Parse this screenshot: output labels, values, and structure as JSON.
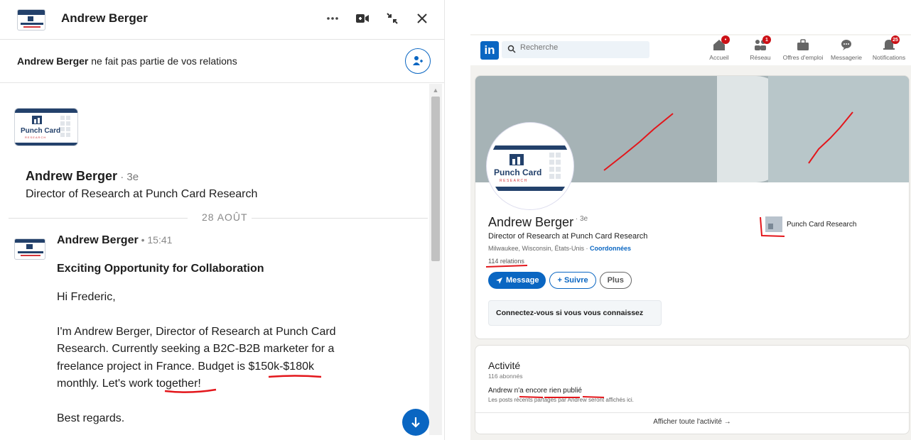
{
  "chat": {
    "header_name": "Andrew Berger",
    "notice_name": "Andrew Berger",
    "notice_rest": " ne fait pas partie de vos relations",
    "logo_text": "Punch Card",
    "logo_subtext": "RESEARCH",
    "profile_name": "Andrew Berger",
    "profile_degree": " · 3e",
    "profile_title": "Director of Research at Punch Card Research",
    "date_label": "28 AOÛT",
    "sender": "Andrew Berger",
    "time": " • 15:41",
    "subject": "Exciting Opportunity for Collaboration",
    "greeting": "Hi Frederic,",
    "body_lines": [
      "I'm Andrew Berger, Director of Research at Punch Card",
      "Research. Currently seeking a B2C-B2B marketer for a",
      "freelance project in France. Budget is $150k-$180k",
      "monthly. Let's work together!"
    ],
    "closing": "Best regards."
  },
  "linkedin": {
    "logo": "in",
    "search_placeholder": "Recherche",
    "nav": [
      {
        "label": "Accueil",
        "icon": "home-icon",
        "badge": "•"
      },
      {
        "label": "Réseau",
        "icon": "network-icon",
        "badge": "1"
      },
      {
        "label": "Offres d'emploi",
        "icon": "briefcase-icon",
        "badge": ""
      },
      {
        "label": "Messagerie",
        "icon": "message-icon",
        "badge": ""
      },
      {
        "label": "Notifications",
        "icon": "bell-icon",
        "badge": "25"
      }
    ],
    "profile": {
      "name": "Andrew Berger",
      "degree": " · 3e",
      "title": "Director of Research at Punch Card Research",
      "location": "Milwaukee, Wisconsin, États-Unis · ",
      "contact_link": "Coordonnées",
      "relations": "114 relations",
      "company": "Punch Card Research",
      "btn_message": "Message",
      "btn_follow": "+ Suivre",
      "btn_more": "Plus",
      "connect_text": "Connectez-vous si vous vous connaissez"
    },
    "activity": {
      "title": "Activité",
      "followers": "116 abonnés",
      "message": "Andrew n'a encore rien publié",
      "note": "Les posts récents partagés par Andrew seront affichés ici.",
      "link": "Afficher toute l'activité →"
    }
  },
  "colors": {
    "linkedin_blue": "#0a66c2",
    "annotation_red": "#e3161b",
    "banner": "#a6b3b6"
  }
}
